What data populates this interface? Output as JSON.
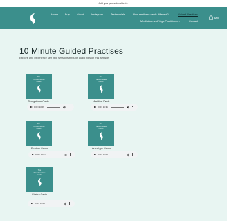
{
  "promo": {
    "text": "Add your promotional text..."
  },
  "nav": {
    "home": "Home",
    "buy": "Buy",
    "about": "About",
    "instagram": "Instagram",
    "testimonials": "Testimonials",
    "cards_different": "How are these cards different?",
    "guided_practises": "Guided Practises",
    "practitioners": "Meditation and Yoga Practitioners",
    "contact": "Contact",
    "bag": "Bag"
  },
  "main": {
    "title": "10 Minute Guided Practises",
    "subtitle": "Explore and experience self help sessions through audio files on this website."
  },
  "card_cover": {
    "line1": "The",
    "line2": "Transformative",
    "line3": "Cards"
  },
  "cards": [
    {
      "label": "Thoughtform Cards",
      "time": "0:00 / 10:09"
    },
    {
      "label": "Meridian Cards",
      "time": "0:00 / 10:31"
    },
    {
      "label": "Emotion Cards",
      "time": "0:00 / 10:01"
    },
    {
      "label": "Archetype Cards",
      "time": "0:00 / 10:02"
    },
    {
      "label": "Chakra Cards",
      "time": "0:00 / 10:09"
    }
  ],
  "colors": {
    "accent": "#3b8f8c",
    "background": "#e8f5f2"
  }
}
